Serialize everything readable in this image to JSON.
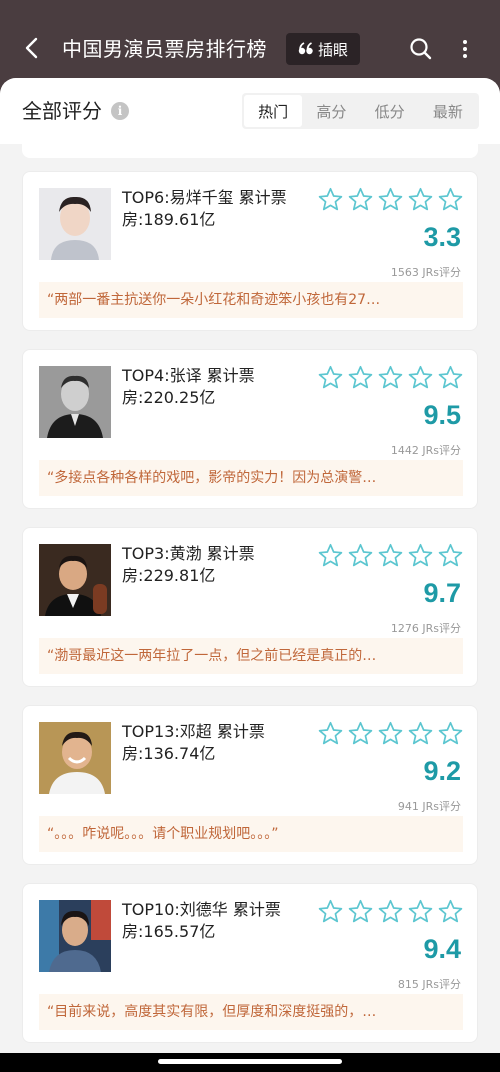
{
  "header": {
    "title": "中国男演员票房排行榜",
    "chip_label": "插眼",
    "back_icon": "back-arrow-icon",
    "search_icon": "search-icon",
    "more_icon": "more-vertical-icon"
  },
  "section": {
    "title": "全部评分",
    "info_icon": "info-icon",
    "tabs": [
      {
        "label": "热门",
        "active": true
      },
      {
        "label": "高分",
        "active": false
      },
      {
        "label": "低分",
        "active": false
      },
      {
        "label": "最新",
        "active": false
      }
    ]
  },
  "colors": {
    "accent": "#1e9aa6",
    "quote_text": "#c0673a",
    "quote_bg": "#fdf6ee",
    "star_outline": "#5cc6d0",
    "header_bg": "#4a3d40"
  },
  "cards": [
    {
      "line1": "TOP6:易烊千玺 累计票",
      "line2": "房:189.61亿",
      "score": "3.3",
      "count": "1563 JRs评分",
      "quote": "“两部一番主抗送你一朵小红花和奇迹笨小孩也有27…"
    },
    {
      "line1": "TOP4:张译 累计票",
      "line2": "房:220.25亿",
      "score": "9.5",
      "count": "1442 JRs评分",
      "quote": "“多接点各种各样的戏吧，影帝的实力！因为总演警…"
    },
    {
      "line1": "TOP3:黄渤 累计票",
      "line2": "房:229.81亿",
      "score": "9.7",
      "count": "1276 JRs评分",
      "quote": "“渤哥最近这一两年拉了一点，但之前已经是真正的…"
    },
    {
      "line1": "TOP13:邓超 累计票",
      "line2": "房:136.74亿",
      "score": "9.2",
      "count": "941 JRs评分",
      "quote": "“。。。咋说呢。。。请个职业规划吧。。。”"
    },
    {
      "line1": "TOP10:刘德华 累计票",
      "line2": "房:165.57亿",
      "score": "9.4",
      "count": "815 JRs评分",
      "quote": "“目前来说，高度其实有限，但厚度和深度挺强的，…"
    }
  ]
}
